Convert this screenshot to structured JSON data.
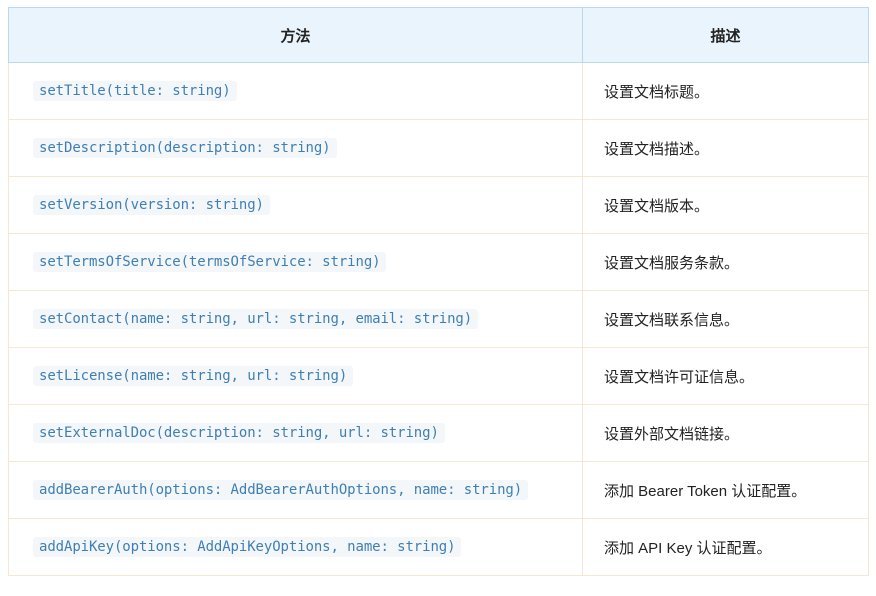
{
  "table": {
    "headers": {
      "method": "方法",
      "description": "描述"
    },
    "rows": [
      {
        "method": "setTitle(title: string)",
        "description": "设置文档标题。"
      },
      {
        "method": "setDescription(description: string)",
        "description": "设置文档描述。"
      },
      {
        "method": "setVersion(version: string)",
        "description": "设置文档版本。"
      },
      {
        "method": "setTermsOfService(termsOfService: string)",
        "description": "设置文档服务条款。"
      },
      {
        "method": "setContact(name: string, url: string, email: string)",
        "description": "设置文档联系信息。"
      },
      {
        "method": "setLicense(name: string, url: string)",
        "description": "设置文档许可证信息。"
      },
      {
        "method": "setExternalDoc(description: string, url: string)",
        "description": "设置外部文档链接。"
      },
      {
        "method": "addBearerAuth(options: AddBearerAuthOptions, name: string)",
        "description": "添加 Bearer Token 认证配置。"
      },
      {
        "method": "addApiKey(options: AddApiKeyOptions, name: string)",
        "description": "添加 API Key 认证配置。"
      }
    ]
  },
  "colors": {
    "header_background": "#eaf4fc",
    "header_border": "#bcd8ef",
    "row_border": "#f6e6d2",
    "code_text": "#3f7fb3",
    "code_background": "#f4f7fa"
  }
}
